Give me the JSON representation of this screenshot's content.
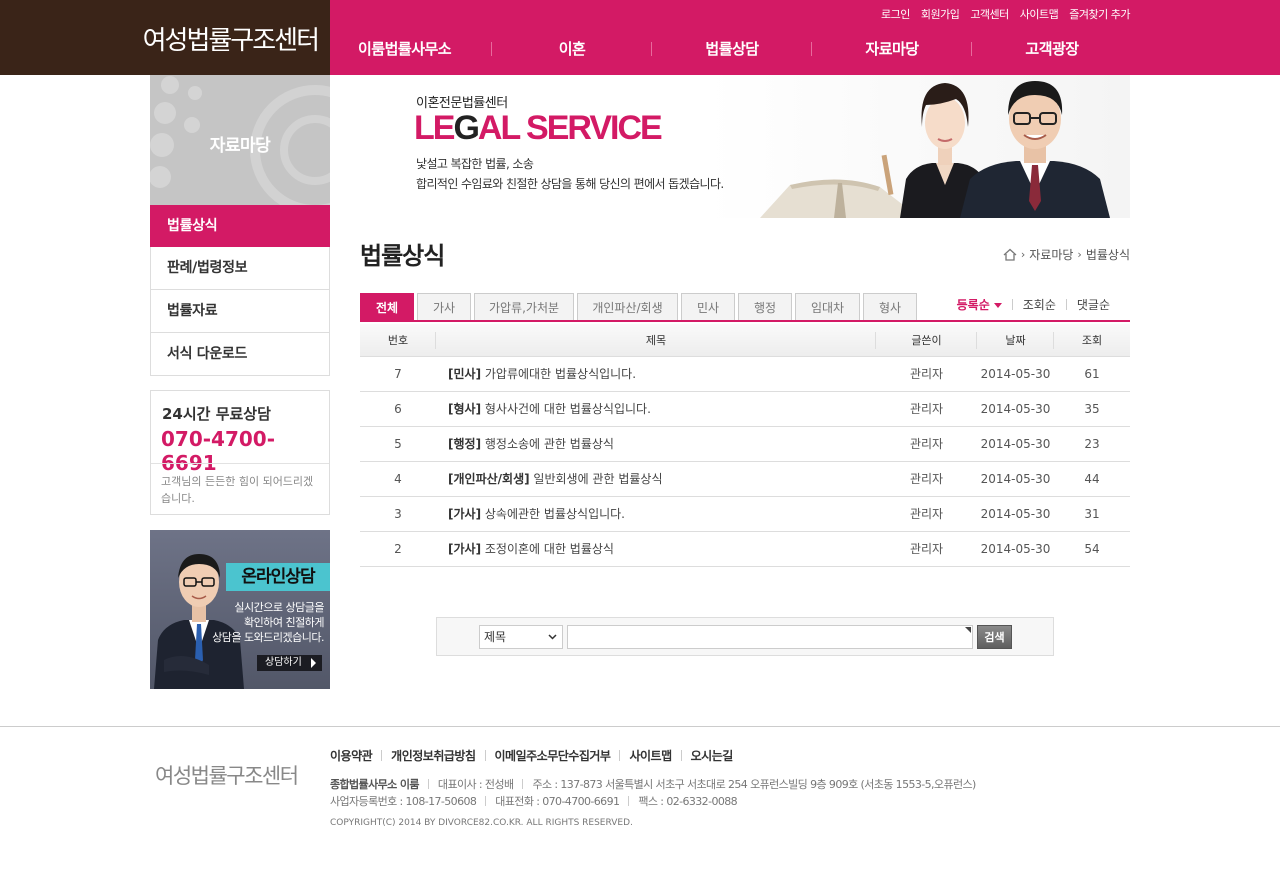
{
  "header": {
    "logo": "여성법률구조센터",
    "util_links": [
      "로그인",
      "회원가입",
      "고객센터",
      "사이트맵",
      "즐겨찾기 추가"
    ],
    "gnb": [
      "이룸법률사무소",
      "이혼",
      "법률상담",
      "자료마당",
      "고객광장"
    ]
  },
  "lnb": {
    "title": "자료마당",
    "items": [
      {
        "label": "법률상식",
        "active": true
      },
      {
        "label": "판례/법령정보",
        "active": false
      },
      {
        "label": "법률자료",
        "active": false
      },
      {
        "label": "서식 다운로드",
        "active": false
      }
    ]
  },
  "consult": {
    "title": "24시간 무료상담",
    "phone": "070-4700-6691",
    "desc": "고객님의 든든한 힘이 되어드리겠습니다."
  },
  "online": {
    "title": "온라인상담",
    "desc_lines": [
      "실시간으로 상담글을",
      "확인하여 친절하게",
      "상담을 도와드리겠습니다."
    ],
    "button": "상담하기"
  },
  "banner": {
    "sub": "이혼전문법률센터",
    "title_pre": "LE",
    "title_g": "G",
    "title_post": "AL SERVICE",
    "desc1": "낯설고 복잡한 법률, 소송",
    "desc2": "합리적인 수임료와 친절한 상담을 통해 당신의 편에서 돕겠습니다."
  },
  "page": {
    "title": "법률상식",
    "breadcrumb": [
      "자료마당",
      "법률상식"
    ]
  },
  "tabs": [
    {
      "label": "전체",
      "active": true,
      "w": 54
    },
    {
      "label": "가사",
      "active": false,
      "w": 54
    },
    {
      "label": "가압류,가처분",
      "active": false,
      "w": 100
    },
    {
      "label": "개인파산/회생",
      "active": false,
      "w": 101
    },
    {
      "label": "민사",
      "active": false,
      "w": 54
    },
    {
      "label": "행정",
      "active": false,
      "w": 54
    },
    {
      "label": "임대차",
      "active": false,
      "w": 65
    },
    {
      "label": "형사",
      "active": false,
      "w": 54
    }
  ],
  "sort": [
    {
      "label": "등록순",
      "active": true
    },
    {
      "label": "조회순",
      "active": false
    },
    {
      "label": "댓글순",
      "active": false
    }
  ],
  "table": {
    "headers": [
      "번호",
      "제목",
      "글쓴이",
      "날짜",
      "조회"
    ],
    "rows": [
      {
        "no": "7",
        "cat": "[민사]",
        "title": "가압류에대한 법률상식입니다.",
        "author": "관리자",
        "date": "2014-05-30",
        "views": "61"
      },
      {
        "no": "6",
        "cat": "[형사]",
        "title": "형사사건에 대한 법률상식입니다.",
        "author": "관리자",
        "date": "2014-05-30",
        "views": "35"
      },
      {
        "no": "5",
        "cat": "[행정]",
        "title": "행정소송에 관한 법률상식",
        "author": "관리자",
        "date": "2014-05-30",
        "views": "23"
      },
      {
        "no": "4",
        "cat": "[개인파산/회생]",
        "title": "일반회생에 관한 법률상식",
        "author": "관리자",
        "date": "2014-05-30",
        "views": "44"
      },
      {
        "no": "3",
        "cat": "[가사]",
        "title": "상속에관한 법률상식입니다.",
        "author": "관리자",
        "date": "2014-05-30",
        "views": "31"
      },
      {
        "no": "2",
        "cat": "[가사]",
        "title": "조정이혼에 대한 법률상식",
        "author": "관리자",
        "date": "2014-05-30",
        "views": "54"
      }
    ]
  },
  "search": {
    "select_value": "제목",
    "button": "검색"
  },
  "footer": {
    "logo": "여성법률구조센터",
    "links": [
      "이용약관",
      "개인정보취급방침",
      "이메일주소무단수집거부",
      "사이트맵",
      "오시는길"
    ],
    "company": "종합법률사무소 이룸",
    "ceo": "대표이사 : 전성배",
    "address": "주소 : 137-873 서울특별시 서초구 서초대로 254 오퓨런스빌딩 9층 909호 (서초동 1553-5,오퓨런스)",
    "biz_no": "사업자등록번호 : 108-17-50608",
    "tel": "대표전화 : 070-4700-6691",
    "fax": "팩스 : 02-6332-0088",
    "copyright": "COPYRIGHT(C) 2014 BY DIVORCE82.CO.KR. ALL RIGHTS RESERVED."
  }
}
